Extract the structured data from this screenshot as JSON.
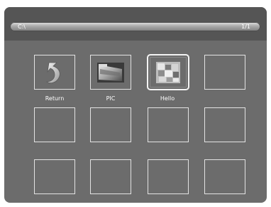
{
  "header": {
    "path": "C:\\",
    "page_counter": "1/1"
  },
  "grid": {
    "items": [
      {
        "label": "Return",
        "icon": "return-arrow-icon",
        "type": "return"
      },
      {
        "label": "PIC",
        "icon": "folder-image-icon",
        "type": "folder"
      },
      {
        "label": "Hello",
        "icon": "picture-file-icon",
        "type": "image",
        "selected": true
      },
      {
        "label": "",
        "type": "empty"
      },
      {
        "label": "",
        "type": "empty"
      },
      {
        "label": "",
        "type": "empty"
      },
      {
        "label": "",
        "type": "empty"
      },
      {
        "label": "",
        "type": "empty"
      },
      {
        "label": "",
        "type": "empty"
      },
      {
        "label": "",
        "type": "empty"
      },
      {
        "label": "",
        "type": "empty"
      },
      {
        "label": "",
        "type": "empty"
      }
    ]
  },
  "colors": {
    "background": "#6c6c6c",
    "header_band": "#555555",
    "tile_border": "#e3e3e3",
    "text": "#ffffff"
  }
}
